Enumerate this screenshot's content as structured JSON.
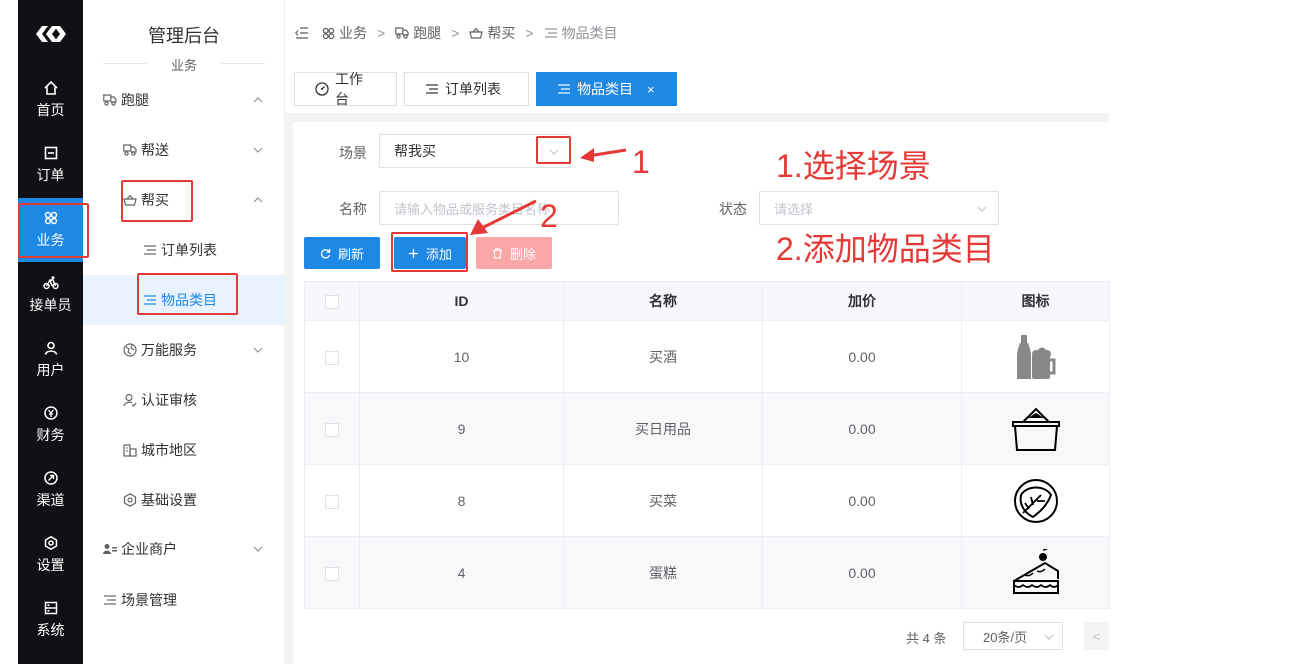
{
  "rail": {
    "items": [
      {
        "label": "首页",
        "icon": "home-icon"
      },
      {
        "label": "订单",
        "icon": "order-icon"
      },
      {
        "label": "业务",
        "icon": "business-icon",
        "active": true
      },
      {
        "label": "接单员",
        "icon": "courier-icon"
      },
      {
        "label": "用户",
        "icon": "user-icon"
      },
      {
        "label": "财务",
        "icon": "finance-icon"
      },
      {
        "label": "渠道",
        "icon": "channel-icon"
      },
      {
        "label": "设置",
        "icon": "settings-icon"
      },
      {
        "label": "系统",
        "icon": "system-icon"
      }
    ]
  },
  "menu": {
    "title": "管理后台",
    "subtitle": "业务",
    "items": [
      {
        "label": "跑腿",
        "icon": "errand-icon"
      },
      {
        "label": "帮送",
        "icon": "deliver-icon"
      },
      {
        "label": "帮买",
        "icon": "basket-icon"
      },
      {
        "label": "订单列表",
        "icon": "list-icon"
      },
      {
        "label": "物品类目",
        "icon": "list-icon"
      },
      {
        "label": "万能服务",
        "icon": "globe-icon"
      },
      {
        "label": "认证审核",
        "icon": "verify-icon"
      },
      {
        "label": "城市地区",
        "icon": "city-icon"
      },
      {
        "label": "基础设置",
        "icon": "gear-icon"
      },
      {
        "label": "企业商户",
        "icon": "merchant-icon"
      },
      {
        "label": "场景管理",
        "icon": "list-icon"
      }
    ]
  },
  "breadcrumb": {
    "items": [
      "业务",
      "跑腿",
      "帮买",
      "物品类目"
    ]
  },
  "tabs": {
    "items": [
      {
        "label": "工作台"
      },
      {
        "label": "订单列表"
      },
      {
        "label": "物品类目",
        "active": true
      }
    ],
    "close": "×"
  },
  "filters": {
    "scene_label": "场景",
    "scene_value": "帮我买",
    "name_label": "名称",
    "name_placeholder": "请输入物品或服务类目名称",
    "status_label": "状态",
    "status_placeholder": "请选择"
  },
  "toolbar": {
    "refresh": "刷新",
    "add": "添加",
    "delete": "删除"
  },
  "table": {
    "headers": [
      "ID",
      "名称",
      "加价",
      "图标"
    ],
    "rows": [
      {
        "id": "10",
        "name": "买酒",
        "price": "0.00",
        "icon": "beer-icon"
      },
      {
        "id": "9",
        "name": "买日用品",
        "price": "0.00",
        "icon": "basket-icon"
      },
      {
        "id": "8",
        "name": "买菜",
        "price": "0.00",
        "icon": "cabbage-icon"
      },
      {
        "id": "4",
        "name": "蛋糕",
        "price": "0.00",
        "icon": "cake-icon"
      }
    ]
  },
  "pagination": {
    "total": "共 4 条",
    "page_size": "20条/页",
    "prev": "<"
  },
  "annotations": {
    "num1": "1",
    "num2": "2",
    "step1": "1.选择场景",
    "step2": "2.添加物品类目"
  },
  "colors": {
    "primary": "#1e88e5",
    "danger_light": "#f9a7a7",
    "annotation_red": "#e53935",
    "rail_bg": "#0f1115"
  }
}
